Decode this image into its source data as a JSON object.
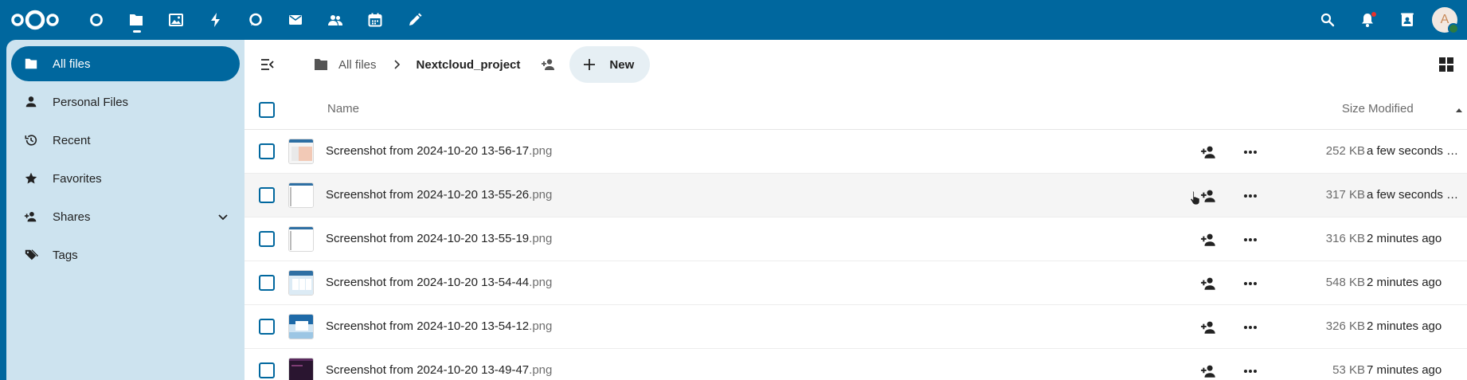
{
  "header": {
    "apps": [
      {
        "icon": "dashboard-icon",
        "active": false
      },
      {
        "icon": "files-icon",
        "active": true
      },
      {
        "icon": "photos-icon",
        "active": false
      },
      {
        "icon": "activity-icon",
        "active": false
      },
      {
        "icon": "talk-icon",
        "active": false
      },
      {
        "icon": "mail-icon",
        "active": false
      },
      {
        "icon": "contacts-icon",
        "active": false
      },
      {
        "icon": "calendar-icon",
        "active": false
      },
      {
        "icon": "notes-icon",
        "active": false
      }
    ],
    "avatar_initial": "A",
    "colors": {
      "primary": "#00679e",
      "status_online": "#2d7b41",
      "notification": "#e9322d"
    }
  },
  "sidebar": {
    "items": [
      {
        "label": "All files",
        "icon": "folder-icon",
        "active": true
      },
      {
        "label": "Personal Files",
        "icon": "person-icon",
        "active": false
      },
      {
        "label": "Recent",
        "icon": "history-icon",
        "active": false
      },
      {
        "label": "Favorites",
        "icon": "star-icon",
        "active": false
      },
      {
        "label": "Shares",
        "icon": "share-icon",
        "active": false,
        "expandable": true
      },
      {
        "label": "Tags",
        "icon": "tag-icon",
        "active": false
      }
    ]
  },
  "toolbar": {
    "breadcrumb_root": "All files",
    "breadcrumb_current": "Nextcloud_project",
    "new_label": "New"
  },
  "table": {
    "columns": {
      "name": "Name",
      "size": "Size",
      "modified": "Modified"
    },
    "sort": {
      "column": "modified",
      "direction": "ascending"
    },
    "rows": [
      {
        "base": "Screenshot from 2024-10-20 13-56-17",
        "ext": ".png",
        "size": "252 KB",
        "modified": "a few seconds ago",
        "thumb": "pink"
      },
      {
        "base": "Screenshot from 2024-10-20 13-55-26",
        "ext": ".png",
        "size": "317 KB",
        "modified": "a few seconds ago",
        "thumb": "white",
        "hover": true
      },
      {
        "base": "Screenshot from 2024-10-20 13-55-19",
        "ext": ".png",
        "size": "316 KB",
        "modified": "2 minutes ago",
        "thumb": "white"
      },
      {
        "base": "Screenshot from 2024-10-20 13-54-44",
        "ext": ".png",
        "size": "548 KB",
        "modified": "2 minutes ago",
        "thumb": "blue"
      },
      {
        "base": "Screenshot from 2024-10-20 13-54-12",
        "ext": ".png",
        "size": "326 KB",
        "modified": "2 minutes ago",
        "thumb": "blue"
      },
      {
        "base": "Screenshot from 2024-10-20 13-49-47",
        "ext": ".png",
        "size": "53 KB",
        "modified": "7 minutes ago",
        "thumb": "dark"
      }
    ]
  }
}
